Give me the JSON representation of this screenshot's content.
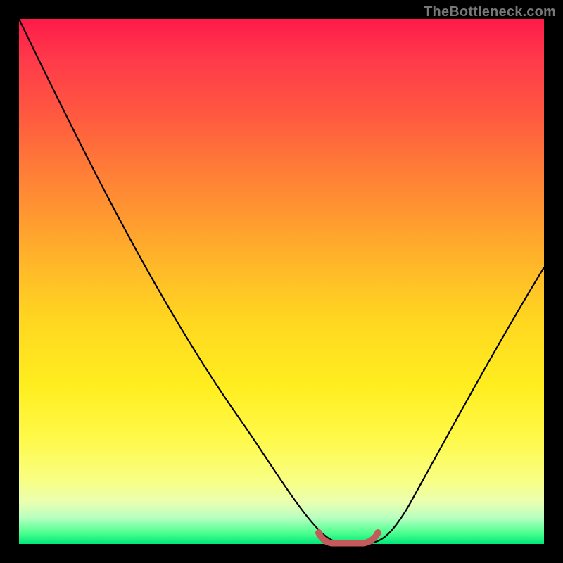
{
  "watermark": "TheBottleneck.com",
  "chart_data": {
    "type": "line",
    "title": "",
    "xlabel": "",
    "ylabel": "",
    "xlim": [
      0,
      100
    ],
    "ylim": [
      0,
      100
    ],
    "x": [
      0,
      6,
      12,
      18,
      24,
      30,
      36,
      42,
      47,
      51,
      55,
      58,
      60,
      63,
      66,
      70,
      75,
      80,
      86,
      92,
      100
    ],
    "values": [
      100,
      89,
      78,
      67,
      56,
      46,
      36,
      27,
      18,
      11,
      6,
      2,
      0,
      0,
      0,
      2,
      7,
      14,
      24,
      35,
      52
    ],
    "gradient_stops": [
      {
        "pos": 0.0,
        "color": "#ff1a4a"
      },
      {
        "pos": 0.5,
        "color": "#ffd820"
      },
      {
        "pos": 0.88,
        "color": "#fff94a"
      },
      {
        "pos": 1.0,
        "color": "#00e679"
      }
    ],
    "marker_segment": {
      "x0": 57,
      "y0": 2,
      "x1": 66,
      "y1": 2
    },
    "curve_stroke": "#000000",
    "marker_stroke": "#c55a5a"
  }
}
